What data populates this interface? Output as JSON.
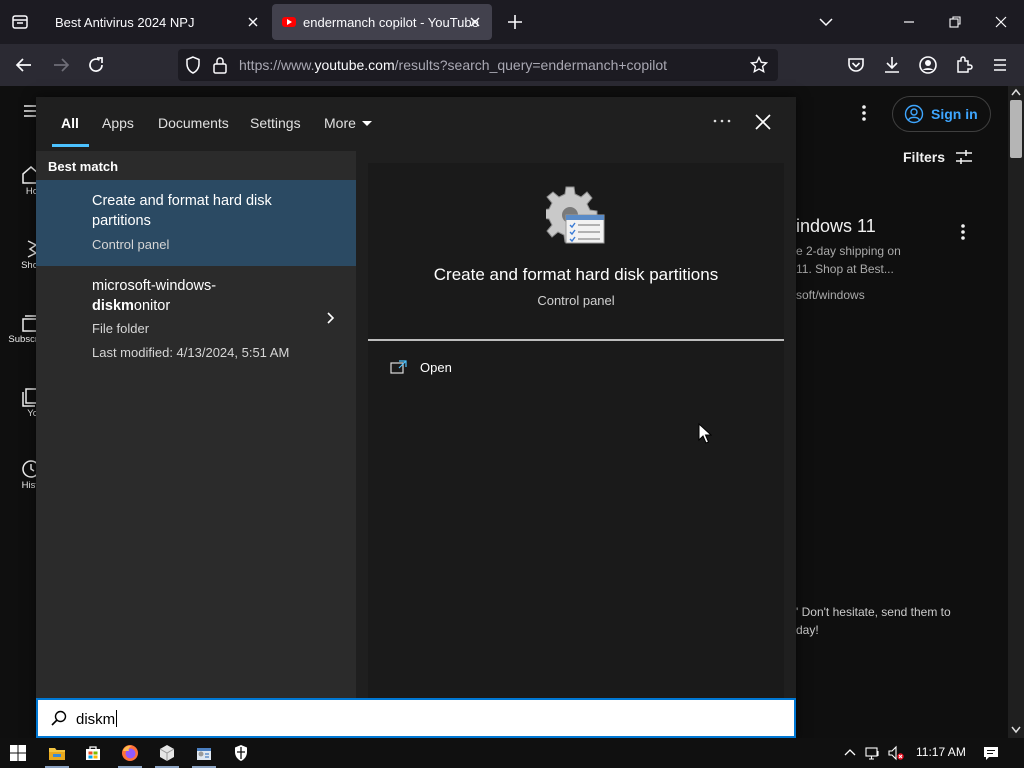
{
  "browser": {
    "tabs": [
      {
        "title": "Best Antivirus 2024 NPJ",
        "active": false
      },
      {
        "title": "endermanch copilot - YouTube",
        "active": true
      }
    ],
    "url": {
      "prefix": "https://www.",
      "host": "youtube.com",
      "path": "/results?search_query=endermanch+copilot"
    },
    "icons": [
      "tab-list-icon",
      "close-icon",
      "plus-icon",
      "chevron-down-icon",
      "minimize-icon",
      "restore-icon",
      "back-icon",
      "forward-icon",
      "reload-icon",
      "shield-icon",
      "lock-icon",
      "star-icon",
      "pocket-icon",
      "download-icon",
      "account-icon",
      "extensions-icon",
      "menu-icon"
    ]
  },
  "youtube": {
    "sidebar": [
      {
        "label": "Ho",
        "icon": "home-icon"
      },
      {
        "label": "Sho",
        "icon": "shorts-icon"
      },
      {
        "label": "Subscr",
        "icon": "subscriptions-icon"
      },
      {
        "label": "Yo",
        "icon": "library-icon"
      },
      {
        "label": "Hist",
        "icon": "history-icon"
      }
    ],
    "sign_in": "Sign in",
    "filters": "Filters",
    "result_title": "indows 11",
    "result_desc1": "e 2-day shipping on",
    "result_desc2": "11. Shop at Best...",
    "result_channel": "soft/windows",
    "comment1": "' Don't hesitate, send them to",
    "comment2": "day!"
  },
  "search": {
    "tabs": [
      "All",
      "Apps",
      "Documents",
      "Settings",
      "More"
    ],
    "active_tab": "All",
    "best_match_label": "Best match",
    "results": [
      {
        "title": "Create and format hard disk partitions",
        "subtitle": "Control panel",
        "selected": true,
        "icon": "disk-management-icon"
      },
      {
        "title_plain": "microsoft-windows-",
        "title_bold": "diskm",
        "title_rest": "onitor",
        "type": "File folder",
        "modified": "Last modified: 4/13/2024, 5:51 AM",
        "selected": false,
        "icon": "folder-icon"
      }
    ],
    "preview": {
      "title": "Create and format hard disk partitions",
      "subtitle": "Control panel",
      "action": "Open",
      "icon": "disk-management-icon"
    },
    "query": "diskm"
  },
  "taskbar": {
    "items": [
      "start-icon",
      "file-explorer-icon",
      "store-icon",
      "firefox-icon",
      "package-icon",
      "app-icon",
      "security-icon"
    ],
    "time": "11:17 AM"
  },
  "colors": {
    "accent": "#4cc2ff",
    "selected_bg": "#2b4a63",
    "link_blue": "#3ea6ff"
  }
}
